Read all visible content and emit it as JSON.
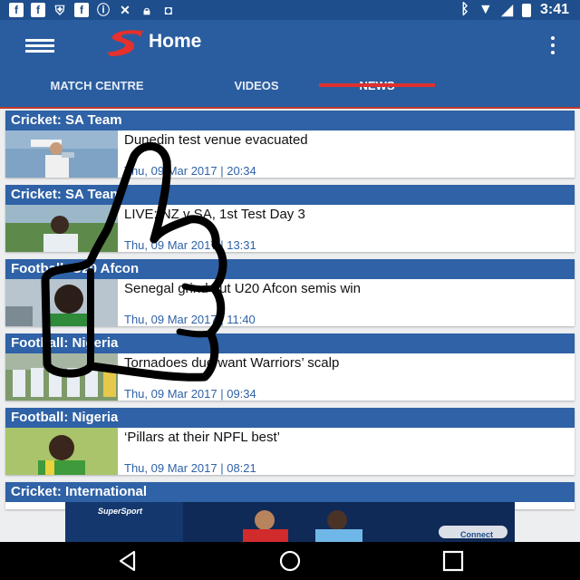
{
  "status_bar": {
    "icons": [
      "facebook-icon",
      "facebook-icon",
      "shield-icon",
      "facebook-icon",
      "info-icon",
      "tools-icon",
      "lock-icon",
      "game-icon"
    ],
    "right_icons": [
      "bluetooth-icon",
      "wifi-icon",
      "signal-icon",
      "battery-icon"
    ],
    "time": "3:41"
  },
  "app_bar": {
    "title": "Home",
    "logo": "supersport-logo",
    "tabs": [
      {
        "label": "MATCH CENTRE",
        "active": false
      },
      {
        "label": "VIDEOS",
        "active": false
      },
      {
        "label": "NEWS",
        "active": true
      }
    ]
  },
  "news": [
    {
      "category": "Cricket: SA Team",
      "headline": "Dunedin test venue evacuated",
      "date": "Thu, 09 Mar 2017 | 20:34"
    },
    {
      "category": "Cricket: SA Team",
      "headline": "LIVE: NZ v SA, 1st Test Day 3",
      "date": "Thu, 09 Mar 2017 | 13:31"
    },
    {
      "category": "Football: U20 Afcon",
      "headline": "Senegal grind out U20 Afcon semis win",
      "date": "Thu, 09 Mar 2017 | 11:40"
    },
    {
      "category": "Football: Nigeria",
      "headline": "Tornadoes duo want Warriors’ scalp",
      "date": "Thu, 09 Mar 2017 | 09:34"
    },
    {
      "category": "Football: Nigeria",
      "headline": "‘Pillars at their NPFL best’",
      "date": "Thu, 09 Mar 2017 | 08:21"
    },
    {
      "category": "Cricket: International"
    }
  ],
  "ad": {
    "brand": "SuperSport",
    "cta": "Connect"
  },
  "colors": {
    "primary": "#2a5d9f",
    "status": "#1e4e8c",
    "accent": "#e0302e",
    "date_text": "#2f62a6"
  }
}
